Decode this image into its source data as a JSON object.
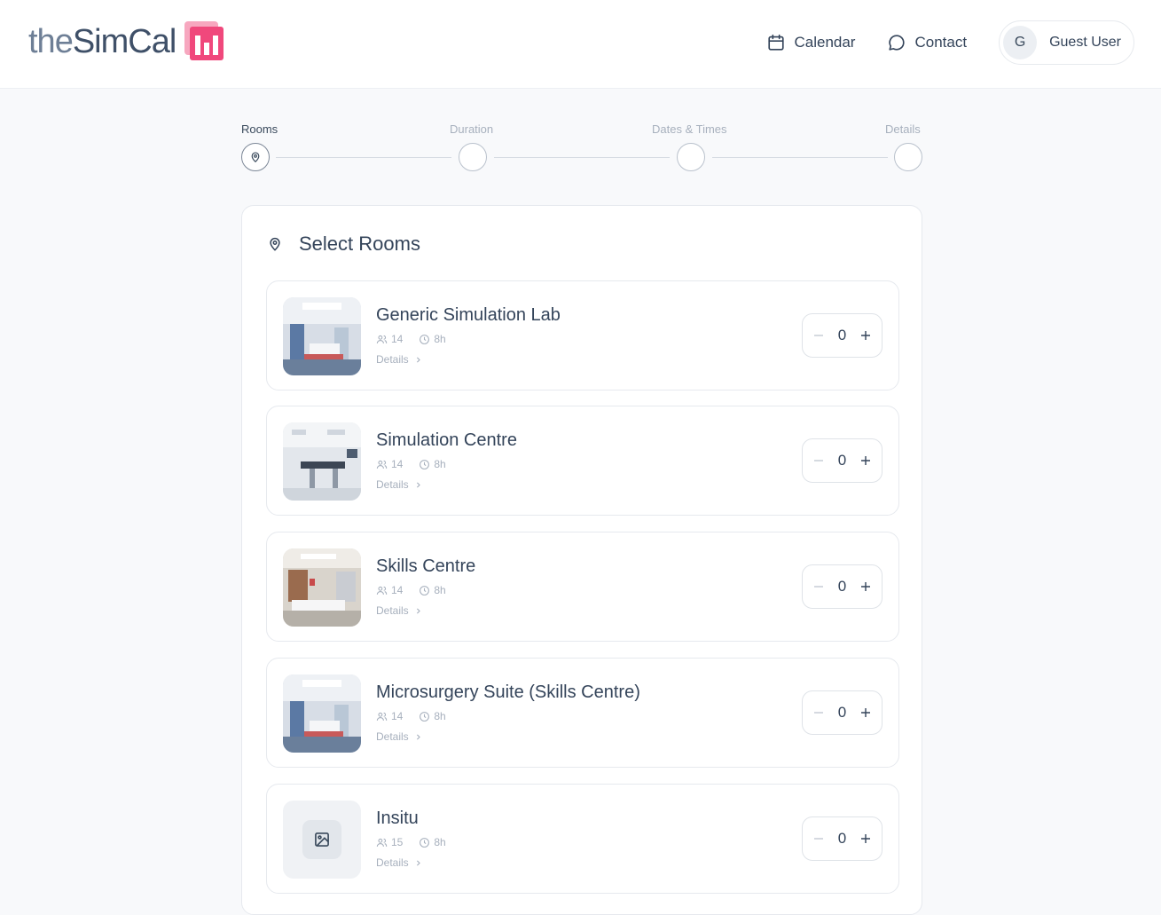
{
  "header": {
    "logo_prefix": "the",
    "logo_main": "SimCal",
    "nav": [
      {
        "label": "Calendar",
        "icon": "calendar-icon"
      },
      {
        "label": "Contact",
        "icon": "chat-bubble-icon"
      }
    ],
    "user": {
      "initial": "G",
      "name": "Guest User"
    }
  },
  "steps": [
    {
      "label": "Rooms",
      "active": true,
      "icon": "map-pin-icon"
    },
    {
      "label": "Duration",
      "active": false
    },
    {
      "label": "Dates & Times",
      "active": false
    },
    {
      "label": "Details",
      "active": false
    }
  ],
  "card": {
    "title": "Select Rooms",
    "icon": "map-pin-icon"
  },
  "rooms": [
    {
      "name": "Generic Simulation Lab",
      "capacity": "14",
      "duration": "8h",
      "details_label": "Details",
      "quantity": "0",
      "image": "room-photo"
    },
    {
      "name": "Simulation Centre",
      "capacity": "14",
      "duration": "8h",
      "details_label": "Details",
      "quantity": "0",
      "image": "room-photo"
    },
    {
      "name": "Skills Centre",
      "capacity": "14",
      "duration": "8h",
      "details_label": "Details",
      "quantity": "0",
      "image": "room-photo"
    },
    {
      "name": "Microsurgery Suite (Skills Centre)",
      "capacity": "14",
      "duration": "8h",
      "details_label": "Details",
      "quantity": "0",
      "image": "room-photo"
    },
    {
      "name": "Insitu",
      "capacity": "15",
      "duration": "8h",
      "details_label": "Details",
      "quantity": "0",
      "image": "image-placeholder-icon"
    }
  ],
  "colors": {
    "brand": "#f0487c",
    "text": "#34445a",
    "muted": "#a7b0bd"
  }
}
